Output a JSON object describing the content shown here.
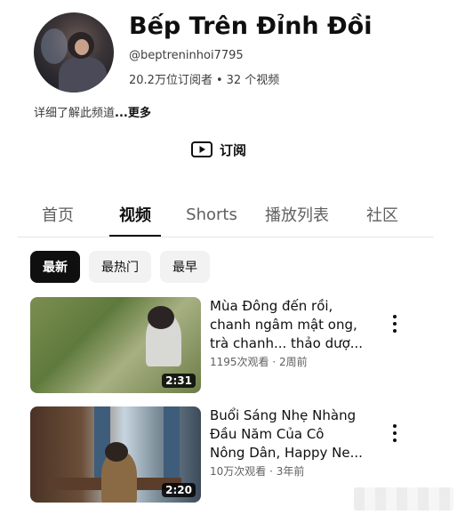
{
  "channel": {
    "name": "Bếp Trên Đỉnh Đồi",
    "handle": "@beptreninhoi7795",
    "subscribers": "20.2万位订阅者",
    "separator": "•",
    "video_count": "32 个视频",
    "about": "详细了解此频道",
    "more": "...更多"
  },
  "subscribe": {
    "label": "订阅",
    "icon": "play-icon"
  },
  "tabs": [
    {
      "label": "首页",
      "active": false
    },
    {
      "label": "视频",
      "active": true
    },
    {
      "label": "Shorts",
      "active": false
    },
    {
      "label": "播放列表",
      "active": false
    },
    {
      "label": "社区",
      "active": false
    }
  ],
  "chips": [
    {
      "label": "最新",
      "active": true
    },
    {
      "label": "最热门",
      "active": false
    },
    {
      "label": "最早",
      "active": false
    }
  ],
  "videos": [
    {
      "title_lines": [
        "Mùa Đông đến rồi,",
        "chanh ngâm mật ong,",
        "trà chanh... thảo dượ..."
      ],
      "meta": "1195次观看 · 2周前",
      "duration": "2:31"
    },
    {
      "title_lines": [
        "Buổi Sáng Nhẹ Nhàng",
        "Đầu Năm Của Cô",
        "Nông Dân, Happy Ne..."
      ],
      "meta": "10万次观看 · 3年前",
      "duration": "2:20"
    }
  ]
}
